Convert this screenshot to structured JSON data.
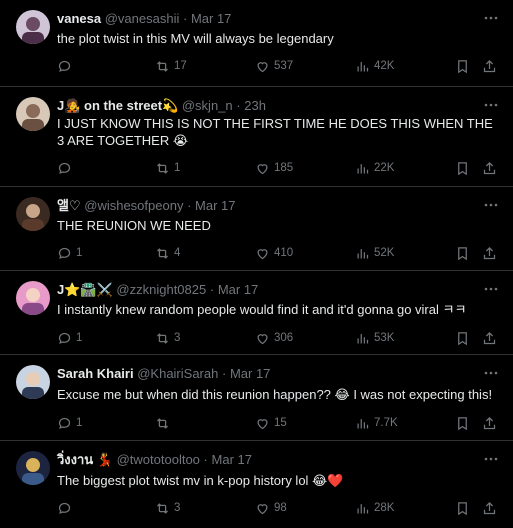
{
  "tweets": [
    {
      "name": "vanesa",
      "handle": "@vanesashii",
      "dot": "·",
      "time": "Mar 17",
      "text": "the plot twist in this MV will always be legendary",
      "replies": "",
      "retweets": "17",
      "likes": "537",
      "views": "42K"
    },
    {
      "name": "J🧑‍🎤 on the street💫",
      "handle": "@skjn_n",
      "dot": "·",
      "time": "23h",
      "text": "I JUST KNOW THIS IS NOT THE FIRST TIME HE DOES THIS WHEN THE 3 ARE TOGETHER 😭",
      "replies": "",
      "retweets": "1",
      "likes": "185",
      "views": "22K"
    },
    {
      "name": "앨♡",
      "handle": "@wishesofpeony",
      "dot": "·",
      "time": "Mar 17",
      "text": "THE REUNION WE NEED",
      "replies": "1",
      "retweets": "4",
      "likes": "410",
      "views": "52K"
    },
    {
      "name": "J⭐🛣️⚔️",
      "handle": "@zzknight0825",
      "dot": "·",
      "time": "Mar 17",
      "text": "I instantly knew random people would find it  and it'd gonna go viral ㅋㅋ",
      "replies": "1",
      "retweets": "3",
      "likes": "306",
      "views": "53K"
    },
    {
      "name": "Sarah Khairi",
      "handle": "@KhairiSarah",
      "dot": "·",
      "time": "Mar 17",
      "text": "Excuse me but when did this reunion happen?? 😂 I was not expecting this!",
      "replies": "1",
      "retweets": "",
      "likes": "15",
      "views": "7.7K"
    },
    {
      "name": "วิ่งงาน 💃",
      "handle": "@twototooltoo",
      "dot": "·",
      "time": "Mar 17",
      "text": "The biggest plot twist mv in k-pop history lol 😂❤️",
      "replies": "",
      "retweets": "3",
      "likes": "98",
      "views": "28K"
    }
  ],
  "colors": {
    "background": "#000000",
    "text": "#e7e9ea",
    "muted": "#71767b",
    "divider": "#2f3336"
  },
  "icons": {
    "reply": "speech-bubble-icon",
    "retweet": "retweet-icon",
    "like": "heart-icon",
    "views": "bar-chart-icon",
    "bookmark": "bookmark-icon",
    "share": "share-icon",
    "more": "more-dots-icon"
  }
}
